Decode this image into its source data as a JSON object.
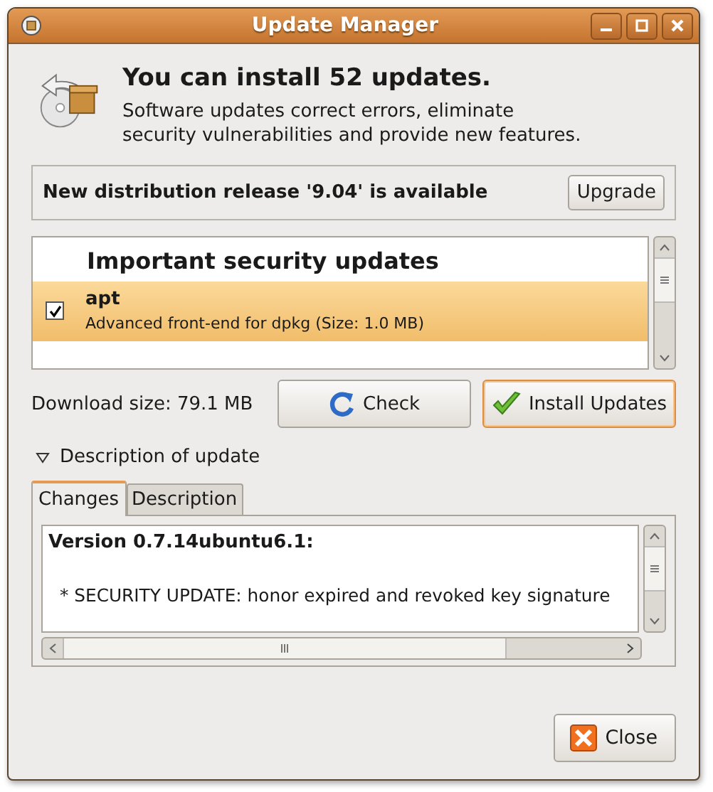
{
  "window": {
    "title": "Update Manager"
  },
  "header": {
    "title": "You can install 52 updates.",
    "description": "Software updates correct errors, eliminate\nsecurity vulnerabilities and provide new features."
  },
  "release": {
    "text": "New distribution release '9.04' is available",
    "button": {
      "label": "Upgrade"
    }
  },
  "updates": {
    "groups": [
      {
        "title": "Important security updates",
        "items": [
          {
            "name": "apt",
            "description": "Advanced front-end for dpkg (Size: 1.0 MB)",
            "checked": true,
            "selected": true
          }
        ]
      }
    ]
  },
  "download_size": "Download size: 79.1 MB",
  "actions": [
    {
      "kind": "check",
      "label": "Check",
      "focused": false
    },
    {
      "kind": "install",
      "label": "Install Updates",
      "focused": true
    }
  ],
  "expander": {
    "label": "Description of update",
    "expanded": true
  },
  "tabs": [
    {
      "label": "Changes",
      "selected": true
    },
    {
      "label": "Description",
      "selected": false
    }
  ],
  "changes": {
    "heading": "Version 0.7.14ubuntu6.1:",
    "lines": [
      "* SECURITY UPDATE: honor expired and revoked key signature"
    ]
  },
  "close_button": {
    "label": "Close"
  }
}
